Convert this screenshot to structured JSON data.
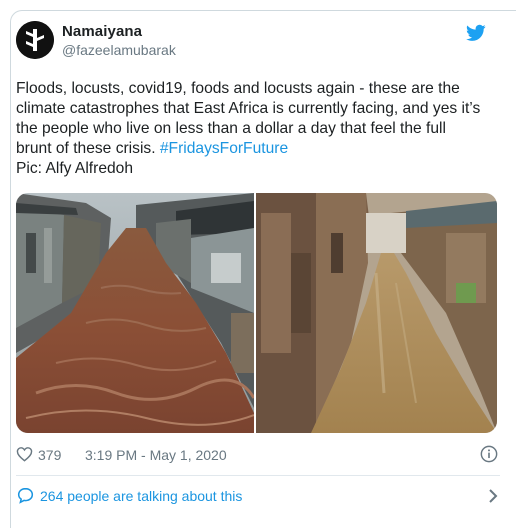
{
  "tweet": {
    "author_name": "Namaiyana",
    "author_handle": "@fazeelamubarak",
    "text_line1": "Floods, locusts, covid19, foods and locusts again - these are the",
    "text_line2": "climate catastrophes that East Africa is currently facing, and yes it’s",
    "text_line3": "the people who live on less than a dollar a day that feel the full",
    "text_line4_prefix": "brunt of these crisis. ",
    "hashtag": "#FridaysForFuture",
    "text_line5": "Pic: Alfy Alfredoh",
    "likes": "379",
    "timestamp": "3:19 PM - May 1, 2020",
    "talking": "264 people are talking about this"
  },
  "colors": {
    "link": "#1b95e0",
    "muted": "#697882",
    "text": "#1c2022",
    "border": "#cfd9de"
  },
  "icons": {
    "brand": "twitter-bird-icon",
    "like": "heart-icon",
    "info": "info-icon",
    "conversation": "speech-bubble-icon",
    "more": "chevron-right-icon"
  }
}
